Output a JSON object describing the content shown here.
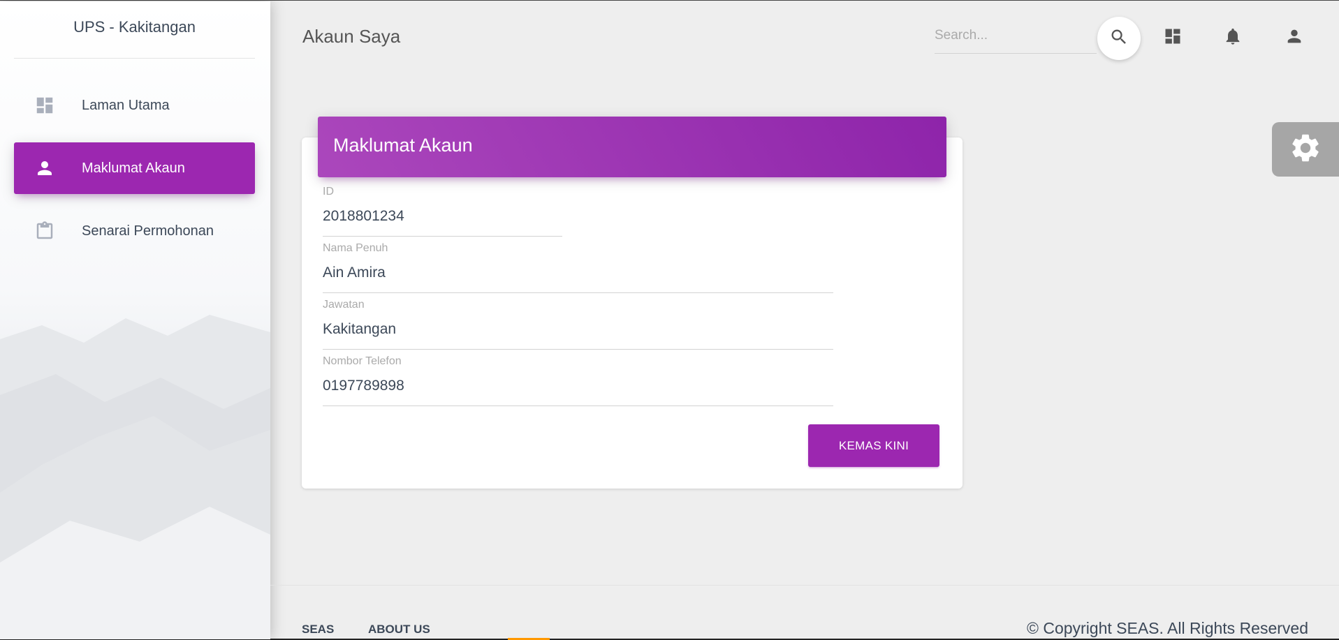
{
  "sidebar": {
    "brand": "UPS - Kakitangan",
    "items": [
      {
        "label": "Laman Utama",
        "icon": "dashboard-icon",
        "active": false
      },
      {
        "label": "Maklumat Akaun",
        "icon": "person-icon",
        "active": true
      },
      {
        "label": "Senarai Permohonan",
        "icon": "clipboard-icon",
        "active": false
      }
    ]
  },
  "header": {
    "title": "Akaun Saya",
    "search_placeholder": "Search...",
    "icons": [
      "search-icon",
      "dashboard-icon",
      "notifications-icon",
      "person-icon"
    ]
  },
  "card": {
    "title": "Maklumat Akaun",
    "fields": [
      {
        "label": "ID",
        "value": "2018801234"
      },
      {
        "label": "Nama Penuh",
        "value": "Ain Amira"
      },
      {
        "label": "Jawatan",
        "value": "Kakitangan"
      },
      {
        "label": "Nombor Telefon",
        "value": "0197789898"
      }
    ],
    "button_label": "KEMAS KINI"
  },
  "footer": {
    "links": [
      "SEAS",
      "ABOUT US"
    ],
    "copyright": "© Copyright SEAS. All Rights Reserved"
  },
  "colors": {
    "primary": "#9c27b0",
    "primary_gradient_start": "#ab47bc",
    "primary_gradient_end": "#8e24aa",
    "background": "#eeeeee",
    "text": "#3c4858"
  }
}
